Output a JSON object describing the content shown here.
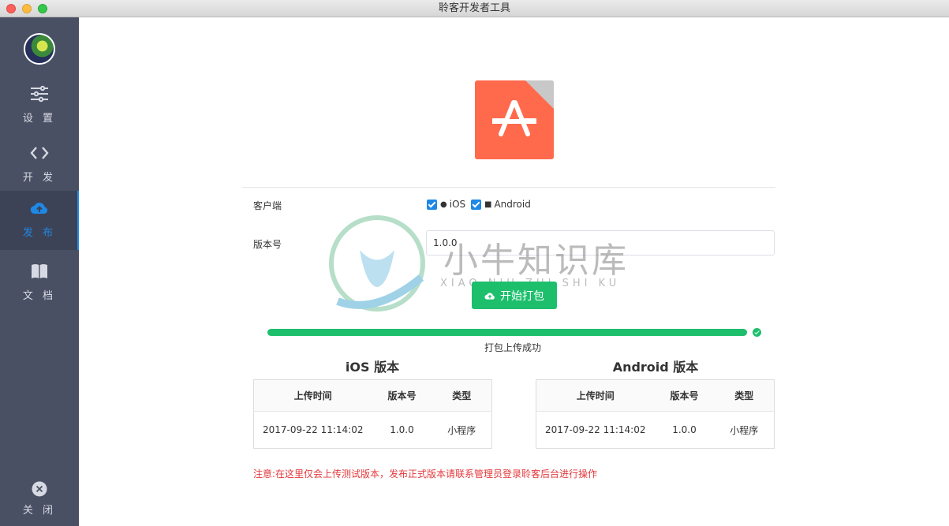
{
  "window": {
    "title": "聆客开发者工具"
  },
  "sidebar": {
    "items": [
      {
        "label": "设 置",
        "icon": "sliders-icon",
        "active": false
      },
      {
        "label": "开 发",
        "icon": "code-icon",
        "active": false
      },
      {
        "label": "发 布",
        "icon": "cloud-upload-icon",
        "active": true
      },
      {
        "label": "文 档",
        "icon": "book-icon",
        "active": false
      }
    ],
    "close_label": "关 闭"
  },
  "form": {
    "client_label": "客户端",
    "clients": [
      {
        "label": "iOS",
        "checked": true
      },
      {
        "label": "Android",
        "checked": true
      }
    ],
    "version_label": "版本号",
    "version_value": "1.0.0",
    "pack_button": "开始打包"
  },
  "progress": {
    "value_percent": 100,
    "text": "打包上传成功"
  },
  "tables": [
    {
      "title": "iOS 版本",
      "headers": [
        "上传时间",
        "版本号",
        "类型"
      ],
      "rows": [
        [
          "2017-09-22 11:14:02",
          "1.0.0",
          "小程序"
        ]
      ]
    },
    {
      "title": "Android 版本",
      "headers": [
        "上传时间",
        "版本号",
        "类型"
      ],
      "rows": [
        [
          "2017-09-22 11:14:02",
          "1.0.0",
          "小程序"
        ]
      ]
    }
  ],
  "notice": "注意:在这里仅会上传测试版本，发布正式版本请联系管理员登录聆客后台进行操作",
  "watermark": {
    "text": "小牛知识库",
    "sub": "XIAO NIU ZHI SHI KU"
  },
  "colors": {
    "accent": "#1e88e5",
    "success": "#1dbf6c",
    "warning": "#e4393c",
    "sidebar": "#4a5064"
  }
}
